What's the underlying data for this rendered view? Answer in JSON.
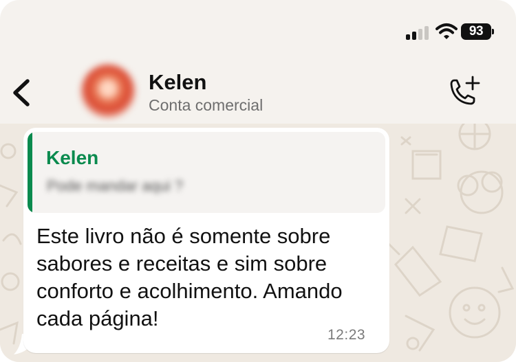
{
  "status_bar": {
    "battery_level": "93",
    "signal_bars_filled": 2,
    "signal_bars_total": 4
  },
  "header": {
    "contact_name": "Kelen",
    "contact_subtitle": "Conta comercial"
  },
  "message": {
    "quoted_author": "Kelen",
    "quoted_text": "Pode mandar aqui ?",
    "text": "Este livro não é somente sobre sabores e receitas e sim sobre conforto e acolhimento. Amando cada página!",
    "time": "12:23"
  },
  "icons": {
    "back": "chevron-left-icon",
    "call": "phone-add-icon",
    "wifi": "wifi-icon",
    "signal": "signal-icon"
  },
  "colors": {
    "accent_green": "#0a8a4e",
    "chat_background": "#efe9e1",
    "bubble": "#ffffff"
  }
}
